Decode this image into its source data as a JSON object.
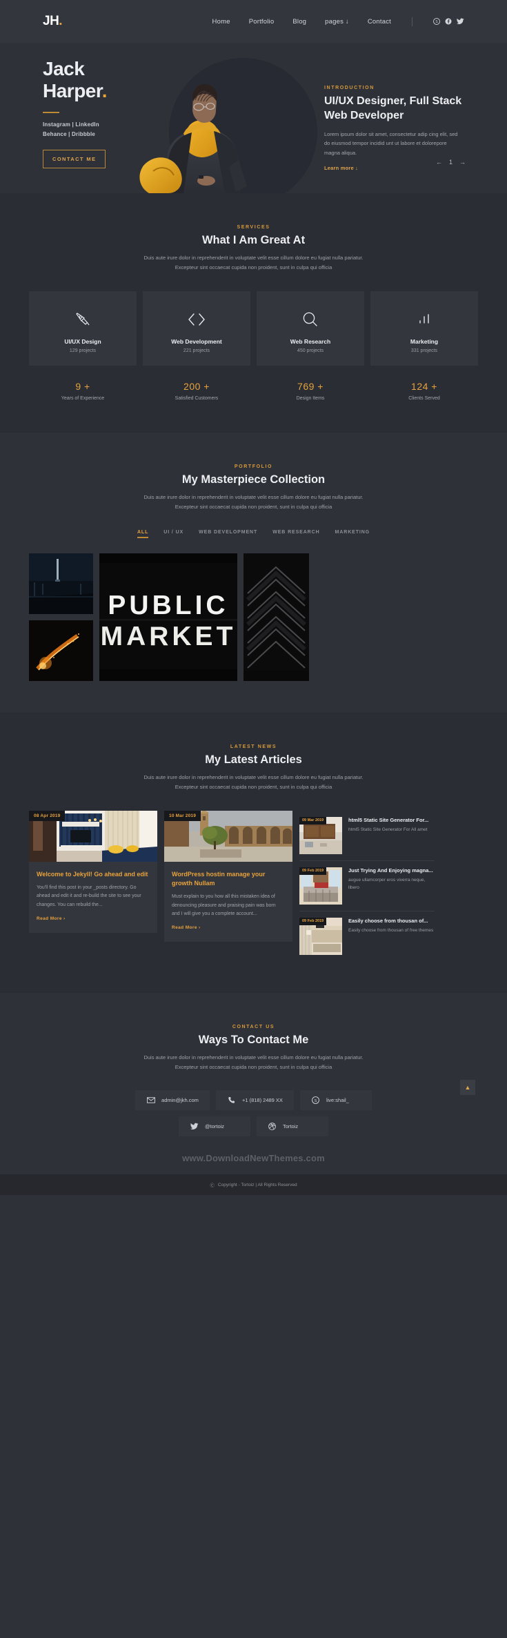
{
  "brand": {
    "logo": "JH",
    "logo_dot": "."
  },
  "nav": {
    "links": [
      {
        "label": "Home"
      },
      {
        "label": "Portfolio"
      },
      {
        "label": "Blog"
      },
      {
        "label": "pages ↓"
      },
      {
        "label": "Contact"
      }
    ],
    "socials": [
      {
        "name": "skype-icon"
      },
      {
        "name": "facebook-icon"
      },
      {
        "name": "twitter-icon"
      }
    ]
  },
  "hero": {
    "name_line1": "Jack",
    "name_line2": "Harper",
    "name_dot": ".",
    "socials_line1": "Instagram | LinkedIn",
    "socials_line2": "Behance | Dribbble",
    "cta": "CONTACT ME",
    "eyebrow": "INTRODUCTION",
    "heading": "UI/UX Designer, Full Stack Web Developer",
    "paragraph": "Lorem ipsum dolor sit amet, consectetur adip cing elit, sed do eiusmod tempor incidid unt ut labore et dolorepore magna aliqua.",
    "learn_more": "Learn more ↓",
    "slide_index": "1",
    "prev": "←",
    "next": "→"
  },
  "services": {
    "eyebrow": "SERVICES",
    "title": "What I Am Great At",
    "desc": "Duis aute irure dolor in reprehenderit in voluptate velit esse cillum dolore eu fugiat nulla pariatur. Excepteur sint occaecat cupida non proident, sunt in culpa qui officia",
    "cards": [
      {
        "icon": "pen-tool-icon",
        "name": "UI/UX Design",
        "sub": "129 projects"
      },
      {
        "icon": "code-brackets-icon",
        "name": "Web Development",
        "sub": "221 projects"
      },
      {
        "icon": "magnifier-icon",
        "name": "Web Research",
        "sub": "450 projects"
      },
      {
        "icon": "bar-chart-icon",
        "name": "Marketing",
        "sub": "331 projects"
      }
    ],
    "stats": [
      {
        "num": "9 +",
        "label": "Years of Experience"
      },
      {
        "num": "200 +",
        "label": "Satisfied Customers"
      },
      {
        "num": "769 +",
        "label": "Design Items"
      },
      {
        "num": "124 +",
        "label": "Clients Served"
      }
    ]
  },
  "portfolio": {
    "eyebrow": "PORTFOLIO",
    "title": "My Masterpiece Collection",
    "desc": "Duis aute irure dolor in reprehenderit in voluptate velit esse cillum dolore eu fugiat nulla pariatur. Excepteur sint occaecat cupida non proident, sunt in culpa qui officia",
    "filters": [
      {
        "label": "ALL",
        "active": true
      },
      {
        "label": "UI / UX",
        "active": false
      },
      {
        "label": "WEB DEVELOPMENT",
        "active": false
      },
      {
        "label": "WEB RESEARCH",
        "active": false
      },
      {
        "label": "MARKETING",
        "active": false
      }
    ],
    "tiles": [
      {
        "name": "dark-corridor-photo"
      },
      {
        "name": "fire-sparks-photo"
      },
      {
        "name": "public-market-neon-sign-photo"
      },
      {
        "name": "black-staircase-photo"
      }
    ]
  },
  "blog": {
    "eyebrow": "LATEST NEWS",
    "title": "My Latest Articles",
    "desc": "Duis aute irure dolor in reprehenderit in voluptate velit esse cillum dolore eu fugiat nulla pariatur. Excepteur sint occaecat cupida non proident, sunt in culpa qui officia",
    "read_more": "Read More  ›",
    "cards": [
      {
        "date": "08 Apr 2019",
        "title": "Welcome to Jekyll! Go ahead and edit",
        "excerpt": "You'll find this post in your _posts directory. Go ahead and edit it and re-build the site to see your changes. You can rebuild the..."
      },
      {
        "date": "10 Mar 2019",
        "title": "WordPress hostin manage your growth Nullam",
        "excerpt": "Must explain to you how all this mistaken idea of denouncing pleasure and praising pain was born and I will give you a complete account..."
      }
    ],
    "side_items": [
      {
        "date": "09 Mar 2019",
        "title": "html5 Static Site Generator For...",
        "excerpt": "html5 Static Site Generator For All amet"
      },
      {
        "date": "09 Feb 2019",
        "title": "Just Trying And Enjoying magna...",
        "excerpt": "augue ullamcorper eros viverra neque, libero"
      },
      {
        "date": "09 Feb 2019",
        "title": "Easily choose from thousan of...",
        "excerpt": "Easily choose from thousan of free themes"
      }
    ]
  },
  "contact": {
    "eyebrow": "CONTACT US",
    "title": "Ways To Contact Me",
    "desc": "Duis aute irure dolor in reprehenderit in voluptate velit esse cillum dolore eu fugiat nulla pariatur. Excepteur sint occaecat cupida non proident, sunt in culpa qui officia",
    "row1": [
      {
        "icon": "envelope-icon",
        "text": "admin@jkh.com"
      },
      {
        "icon": "phone-icon",
        "text": "+1 (818) 2489 XX"
      },
      {
        "icon": "skype-icon",
        "text": "live:shail_"
      }
    ],
    "row2": [
      {
        "icon": "twitter-icon",
        "text": "@tortoiz"
      },
      {
        "icon": "dribbble-icon",
        "text": "Tortoiz"
      }
    ]
  },
  "footer": {
    "watermark": "www.DownloadNewThemes.com",
    "copyright": "Copyright - Tortoiz | All Rights Reserved",
    "copy_symbol": "Ⓒ",
    "to_top": "▲"
  },
  "colors": {
    "accent": "#e8a33d",
    "bg_dark": "#2a2d34",
    "bg_darker": "#2e3138",
    "card": "#33363d"
  }
}
